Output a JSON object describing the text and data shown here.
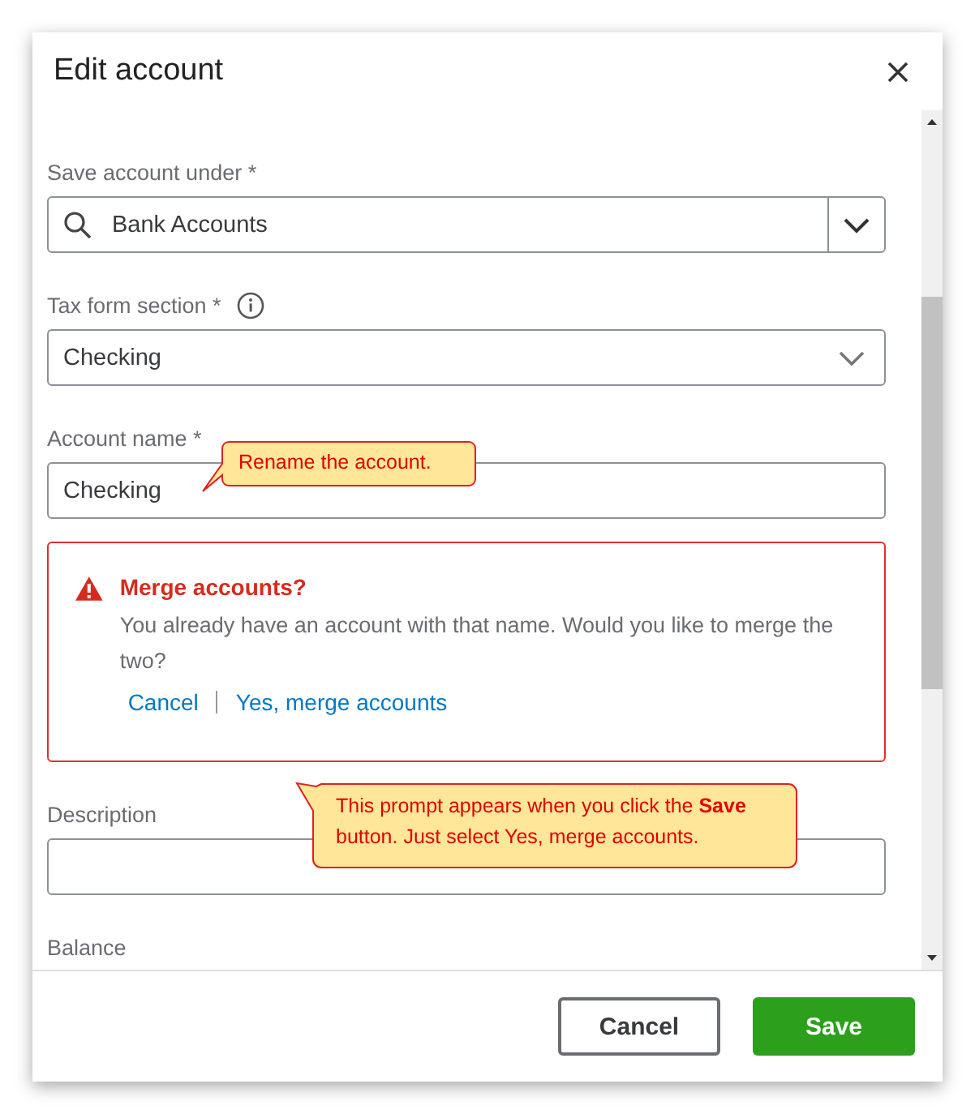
{
  "dialog": {
    "title": "Edit account"
  },
  "form": [
    {
      "kind": "search-select",
      "label": "Save account under *",
      "value": "Bank Accounts"
    },
    {
      "kind": "select",
      "label": "Tax form section *",
      "info": true,
      "value": "Checking"
    },
    {
      "kind": "text",
      "label": "Account name *",
      "value": "Checking"
    },
    {
      "kind": "alert",
      "title": "Merge accounts?",
      "message": "You already have an account with that name. Would you like to merge the two?",
      "actions": [
        "Cancel",
        "Yes, merge accounts"
      ]
    },
    {
      "kind": "text",
      "label": "Description"
    },
    {
      "kind": "text",
      "label": "Balance"
    }
  ],
  "footer": {
    "buttons": [
      {
        "label": "Cancel",
        "kind": "secondary"
      },
      {
        "label": "Save",
        "kind": "primary"
      }
    ]
  },
  "callouts": [
    {
      "text": "Rename the account."
    },
    {
      "text": "This prompt appears when you click the **Save** button. Just select Yes, merge accounts."
    }
  ]
}
